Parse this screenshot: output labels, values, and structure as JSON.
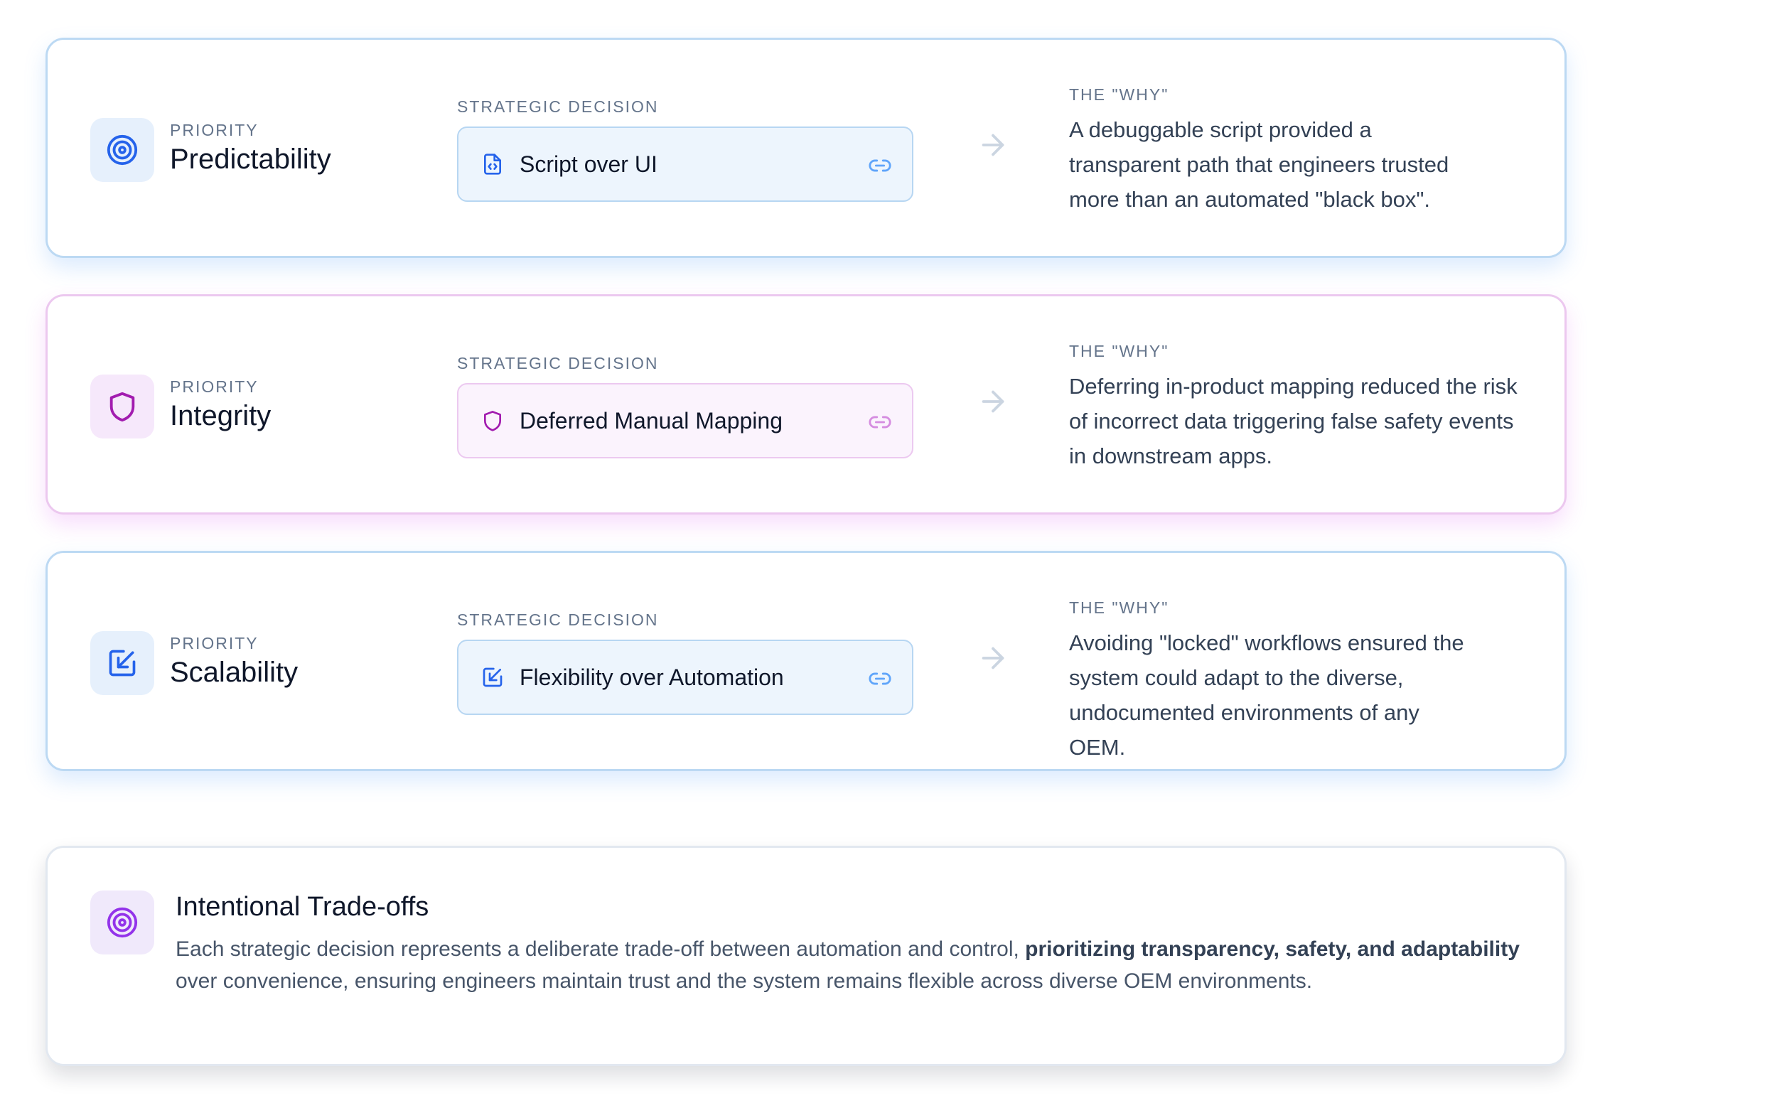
{
  "colors": {
    "blue_accent": "#2563eb",
    "purple_accent": "#a21caf",
    "violet_accent": "#9333ea",
    "muted": "#64748b"
  },
  "cards": [
    {
      "theme": "blue",
      "icon": "target-icon",
      "priority_label": "PRIORITY",
      "priority": "Predictability",
      "decision_label": "STRATEGIC DECISION",
      "decision_icon": "file-code-icon",
      "decision": "Script over UI",
      "why_label": "THE \"WHY\"",
      "why": "A debuggable script provided a transparent path that engineers trusted more than an automated \"black box\"."
    },
    {
      "theme": "purple",
      "icon": "shield-icon",
      "priority_label": "PRIORITY",
      "priority": "Integrity",
      "decision_label": "STRATEGIC DECISION",
      "decision_icon": "shield-icon",
      "decision": "Deferred Manual Mapping",
      "why_label": "THE \"WHY\"",
      "why": "Deferring in-product mapping reduced the risk of incorrect data triggering false safety events in downstream apps."
    },
    {
      "theme": "blue",
      "icon": "external-edit-icon",
      "priority_label": "PRIORITY",
      "priority": "Scalability",
      "decision_label": "STRATEGIC DECISION",
      "decision_icon": "external-edit-icon",
      "decision": "Flexibility over Automation",
      "why_label": "THE \"WHY\"",
      "why": "Avoiding \"locked\" workflows ensured the system could adapt to the diverse, undocumented environments of any OEM."
    }
  ],
  "summary": {
    "icon": "target-icon",
    "title": "Intentional Trade-offs",
    "text_before": "Each strategic decision represents a deliberate trade-off between automation and control, ",
    "text_bold": "prioritizing transparency, safety, and adaptability",
    "text_after": " over convenience, ensuring engineers maintain trust and the system remains flexible across diverse OEM environments."
  }
}
